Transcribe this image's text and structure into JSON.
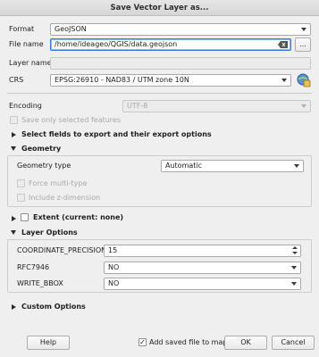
{
  "window": {
    "title": "Save Vector Layer as..."
  },
  "format": {
    "label": "Format",
    "value": "GeoJSON"
  },
  "file_name": {
    "label": "File name",
    "value": "/home/ideageo/QGIS/data.geojson",
    "browse_label": "..."
  },
  "layer_name": {
    "label": "Layer name",
    "value": ""
  },
  "crs": {
    "label": "CRS",
    "value": "EPSG:26910 - NAD83 / UTM zone 10N"
  },
  "encoding": {
    "label": "Encoding",
    "value": "UTF-8"
  },
  "save_only_selected": {
    "label": "Save only selected features"
  },
  "select_fields": {
    "label": "Select fields to export and their export options"
  },
  "geometry": {
    "label": "Geometry",
    "type_label": "Geometry type",
    "type_value": "Automatic",
    "force_multi_label": "Force multi-type",
    "include_z_label": "Include z-dimension"
  },
  "extent": {
    "label": "Extent (current: none)"
  },
  "layer_options": {
    "label": "Layer Options",
    "rows": [
      {
        "name": "COORDINATE_PRECISION",
        "value": "15"
      },
      {
        "name": "RFC7946",
        "value": "NO"
      },
      {
        "name": "WRITE_BBOX",
        "value": "NO"
      }
    ]
  },
  "custom_options": {
    "label": "Custom Options"
  },
  "footer": {
    "help": "Help",
    "add_to_map": "Add saved file to map",
    "ok": "OK",
    "cancel": "Cancel"
  }
}
